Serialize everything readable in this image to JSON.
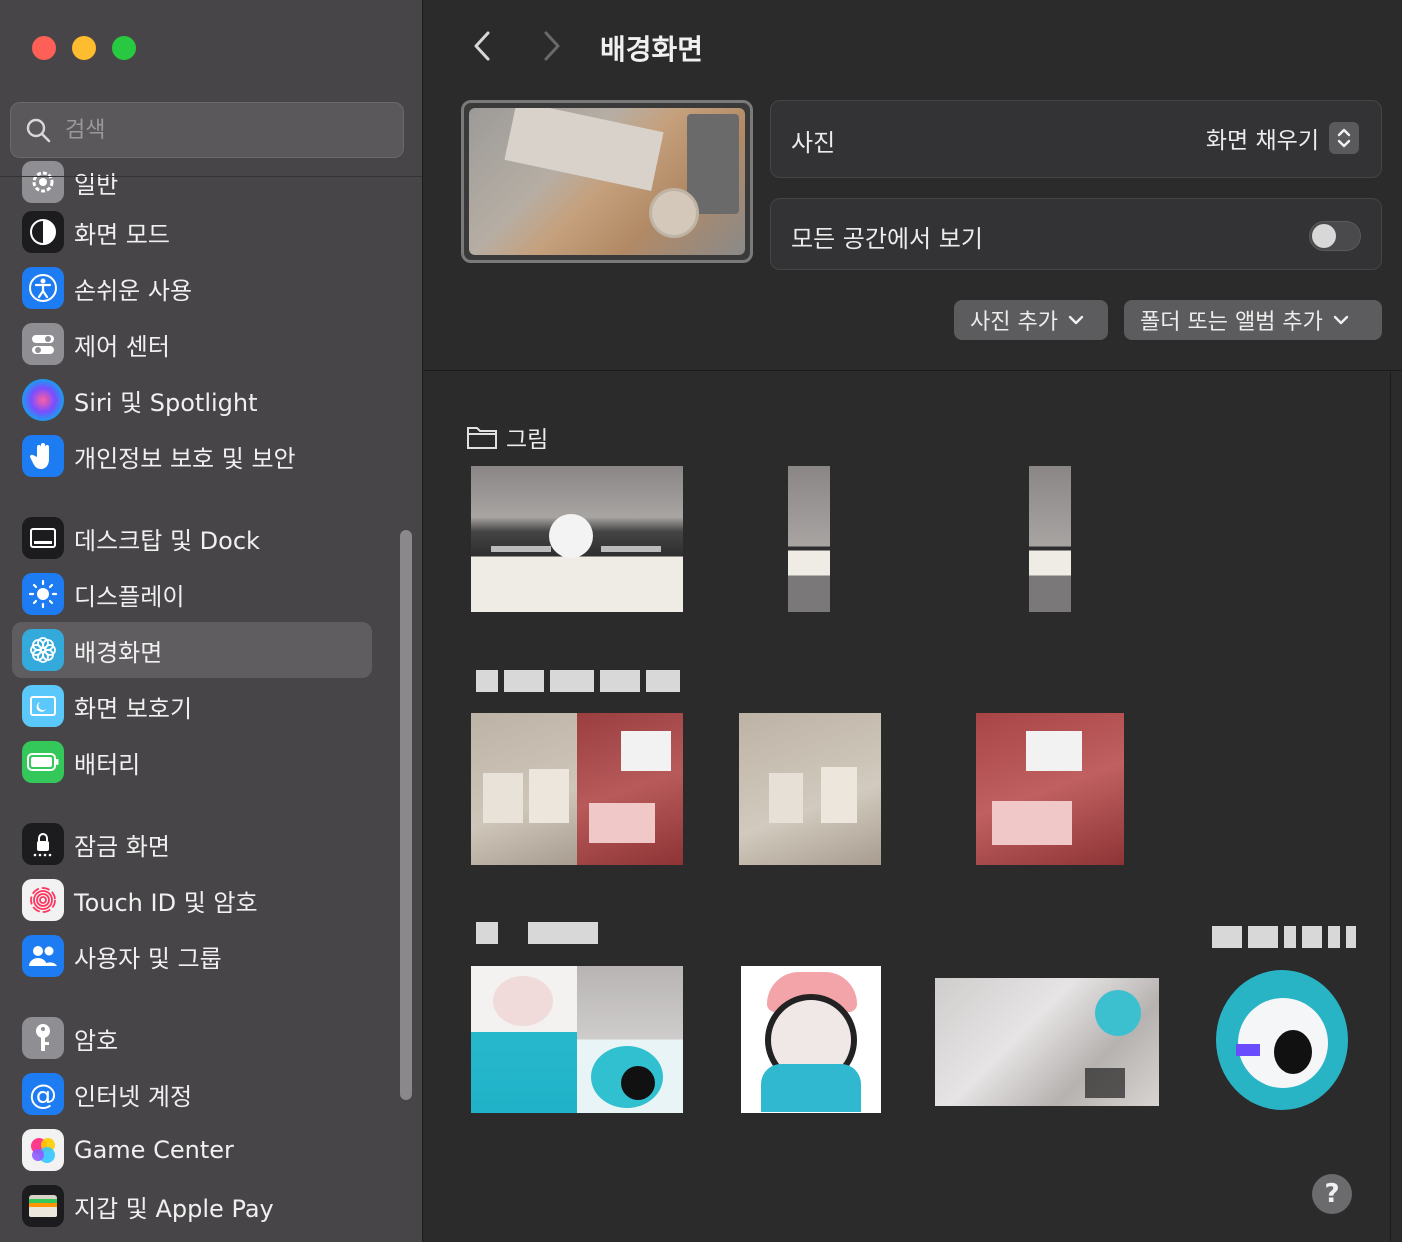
{
  "window": {
    "controls": [
      "close",
      "minimize",
      "zoom"
    ]
  },
  "sidebar": {
    "search_placeholder": "검색",
    "items": [
      {
        "label": "일반",
        "icon": "gear-icon",
        "color": "#8e8e93"
      },
      {
        "label": "화면 모드",
        "icon": "appearance-icon",
        "color": "#1c1c1e"
      },
      {
        "label": "손쉬운 사용",
        "icon": "accessibility-icon",
        "color": "#1e7cf2"
      },
      {
        "label": "제어 센터",
        "icon": "control-center-icon",
        "color": "#8e8e93"
      },
      {
        "label": "Siri 및 Spotlight",
        "icon": "siri-icon",
        "color": "#2a2a6a"
      },
      {
        "label": "개인정보 보호 및 보안",
        "icon": "hand-icon",
        "color": "#1e7cf2"
      },
      {
        "label": "데스크탑 및 Dock",
        "icon": "dock-icon",
        "color": "#1c1c1e"
      },
      {
        "label": "디스플레이",
        "icon": "sun-icon",
        "color": "#1e7cf2"
      },
      {
        "label": "배경화면",
        "icon": "flower-icon",
        "color": "#34aadc"
      },
      {
        "label": "화면 보호기",
        "icon": "screensaver-icon",
        "color": "#5ac8fa"
      },
      {
        "label": "배터리",
        "icon": "battery-icon",
        "color": "#34c759"
      },
      {
        "label": "잠금 화면",
        "icon": "lock-icon",
        "color": "#1c1c1e"
      },
      {
        "label": "Touch ID 및 암호",
        "icon": "fingerprint-icon",
        "color": "#f2f2f2"
      },
      {
        "label": "사용자 및 그룹",
        "icon": "users-icon",
        "color": "#1e7cf2"
      },
      {
        "label": "암호",
        "icon": "key-icon",
        "color": "#8e8e93"
      },
      {
        "label": "인터넷 계정",
        "icon": "at-icon",
        "color": "#1e7cf2"
      },
      {
        "label": "Game Center",
        "icon": "game-center-icon",
        "color": "#f2f2f2"
      },
      {
        "label": "지갑 및 Apple Pay",
        "icon": "wallet-icon",
        "color": "#1c1c1e"
      }
    ],
    "selected": "배경화면"
  },
  "main": {
    "title": "배경화면",
    "photo_label": "사진",
    "fit_option": "화면 채우기",
    "all_spaces_label": "모든 공간에서 보기",
    "all_spaces_enabled": false,
    "add_photo_button": "사진 추가",
    "add_folder_button": "폴더 또는 앨범 추가",
    "section_pictures": "그림",
    "help": "?"
  },
  "colors": {
    "accent": "#1e7cf2",
    "sidebar_bg": "#474547",
    "main_bg": "#2b2b2b"
  }
}
